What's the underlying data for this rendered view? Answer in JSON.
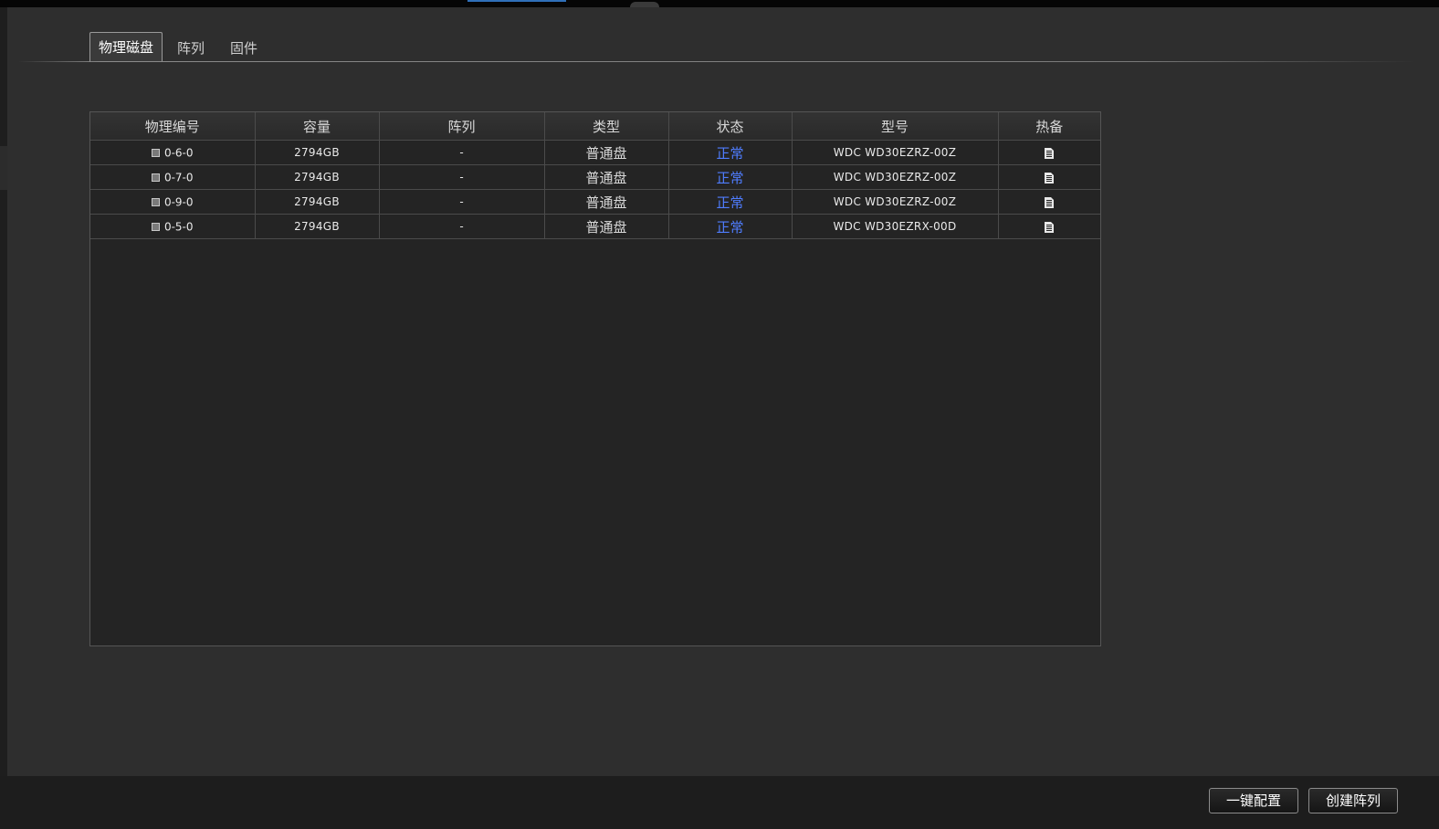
{
  "tabs": [
    {
      "label": "物理磁盘",
      "active": true
    },
    {
      "label": "阵列",
      "active": false
    },
    {
      "label": "固件",
      "active": false
    }
  ],
  "table": {
    "headers": [
      "物理编号",
      "容量",
      "阵列",
      "类型",
      "状态",
      "型号",
      "热备"
    ],
    "rows": [
      {
        "id": "0-6-0",
        "capacity": "2794GB",
        "array": "-",
        "type": "普通盘",
        "status": "正常",
        "model": "WDC WD30EZRZ-00Z",
        "hotspare_icon": "document-icon"
      },
      {
        "id": "0-7-0",
        "capacity": "2794GB",
        "array": "-",
        "type": "普通盘",
        "status": "正常",
        "model": "WDC WD30EZRZ-00Z",
        "hotspare_icon": "document-icon"
      },
      {
        "id": "0-9-0",
        "capacity": "2794GB",
        "array": "-",
        "type": "普通盘",
        "status": "正常",
        "model": "WDC WD30EZRZ-00Z",
        "hotspare_icon": "document-icon"
      },
      {
        "id": "0-5-0",
        "capacity": "2794GB",
        "array": "-",
        "type": "普通盘",
        "status": "正常",
        "model": "WDC WD30EZRX-00D",
        "hotspare_icon": "document-icon"
      }
    ]
  },
  "buttons": {
    "one_click_config": "一键配置",
    "create_array": "创建阵列"
  },
  "colors": {
    "status_normal": "#4f7dff",
    "background": "#2e2e2e",
    "table_background": "#242424"
  }
}
